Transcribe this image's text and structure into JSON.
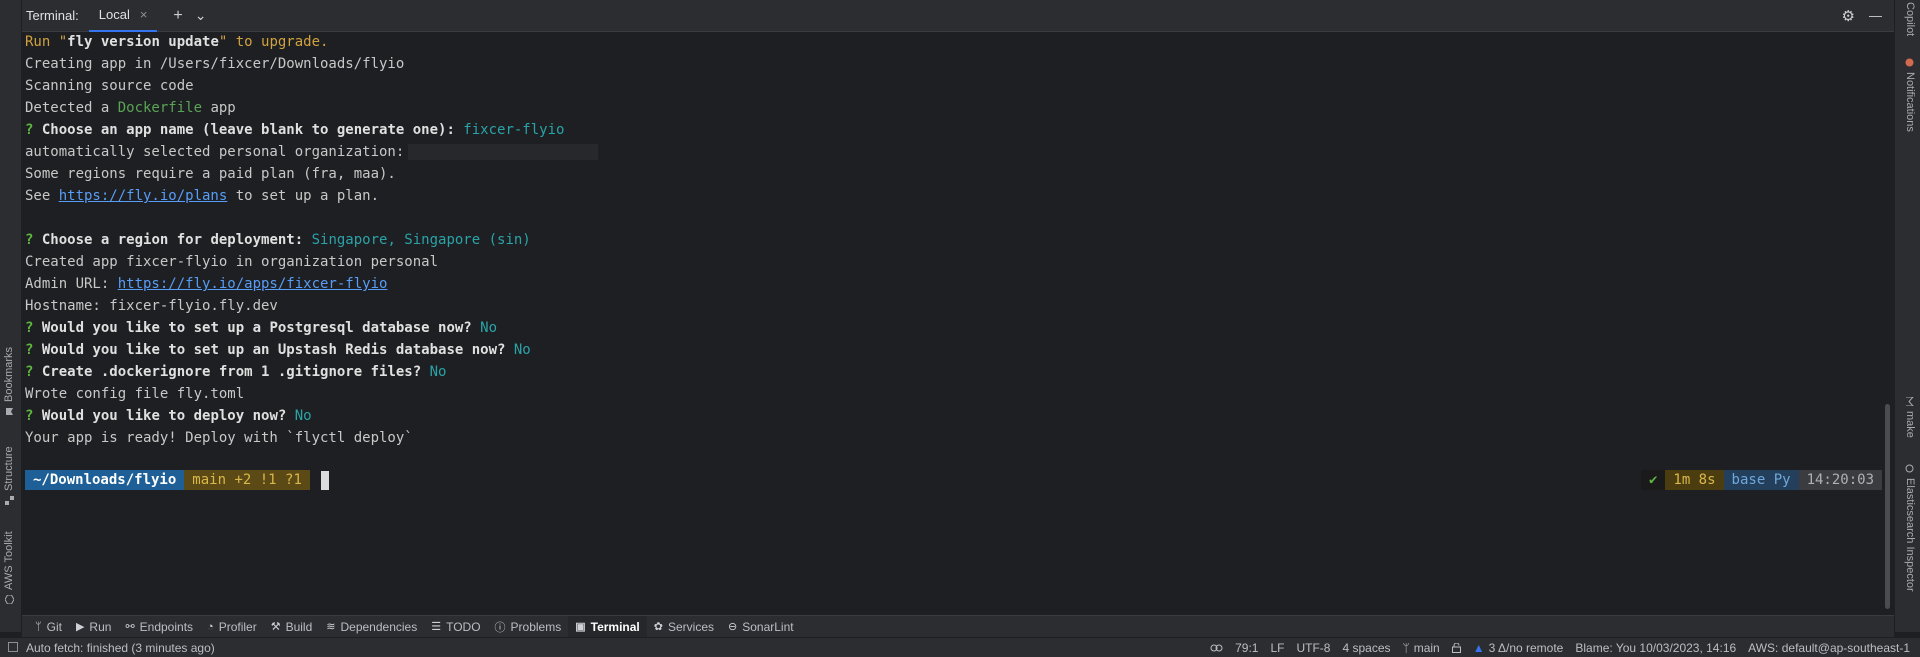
{
  "header": {
    "title": "Terminal:",
    "tab_label": "Local",
    "close_glyph": "×",
    "add_glyph": "+",
    "dropdown_glyph": "⌄",
    "settings_glyph": "⚙",
    "minimize_glyph": "—"
  },
  "left_tools": [
    "Bookmarks",
    "Structure",
    "AWS Toolkit"
  ],
  "right_tools": [
    "Copilot",
    "Notifications",
    "make",
    "Elasticsearch Inspector"
  ],
  "terminal": {
    "l1_a": "Run \"",
    "l1_b": "fly version update",
    "l1_c": "\" to upgrade.",
    "l2": "Creating app in /Users/fixcer/Downloads/flyio",
    "l3": "Scanning source code",
    "l4_a": "Detected a ",
    "l4_b": "Dockerfile",
    "l4_c": " app",
    "q": "?",
    "l5_a": " Choose an app name (leave blank to generate one):",
    "l5_b": " fixcer-flyio",
    "l6": "automatically selected personal organization:",
    "l7": "Some regions require a paid plan (fra, maa).",
    "l8_a": "See ",
    "l8_link": "https://fly.io/plans",
    "l8_c": " to set up a plan.",
    "l9_a": " Choose a region for deployment:",
    "l9_b": " Singapore, Singapore (sin)",
    "l10": "Created app fixcer-flyio in organization personal",
    "l11_a": "Admin URL: ",
    "l11_link": "https://fly.io/apps/fixcer-flyio",
    "l12": "Hostname: fixcer-flyio.fly.dev",
    "l13_a": " Would you like to set up a Postgresql database now?",
    "l13_b": " No",
    "l14_a": " Would you like to set up an Upstash Redis database now?",
    "l14_b": " No",
    "l15_a": " Create .dockerignore from 1 .gitignore files?",
    "l15_b": " No",
    "l16": "Wrote config file fly.toml",
    "l17_a": " Would you like to deploy now?",
    "l17_b": " No",
    "l18": "Your app is ready! Deploy with `flyctl deploy`"
  },
  "prompt": {
    "dir": "~/Downloads/flyio",
    "git": "main +2 !1 ?1",
    "status_ok": "✔",
    "duration": "1m 8s",
    "env": "base Py",
    "time": "14:20:03"
  },
  "tool_tabs": [
    {
      "label": "Git",
      "icon": "git-branch-icon",
      "glyph": "ᛘ"
    },
    {
      "label": "Run",
      "icon": "run-icon",
      "glyph": "▶"
    },
    {
      "label": "Endpoints",
      "icon": "endpoints-icon",
      "glyph": "⚯"
    },
    {
      "label": "Profiler",
      "icon": "profiler-icon",
      "glyph": "◔"
    },
    {
      "label": "Build",
      "icon": "hammer-icon",
      "glyph": "⚒"
    },
    {
      "label": "Dependencies",
      "icon": "layers-icon",
      "glyph": "≋"
    },
    {
      "label": "TODO",
      "icon": "list-icon",
      "glyph": "☰"
    },
    {
      "label": "Problems",
      "icon": "info-icon",
      "glyph": "ⓘ"
    },
    {
      "label": "Terminal",
      "icon": "terminal-icon",
      "glyph": "▣"
    },
    {
      "label": "Services",
      "icon": "services-icon",
      "glyph": "✿"
    },
    {
      "label": "SonarLint",
      "icon": "sonarlint-icon",
      "glyph": "⊖"
    }
  ],
  "status": {
    "fetch": "Auto fetch: finished (3 minutes ago)",
    "position": "79:1",
    "line_sep": "LF",
    "encoding": "UTF-8",
    "indent": "4 spaces",
    "branch": "main",
    "remote": "3 Δ/no remote",
    "blame": "Blame: You 10/03/2023, 14:16",
    "aws": "AWS: default@ap-southeast-1"
  }
}
